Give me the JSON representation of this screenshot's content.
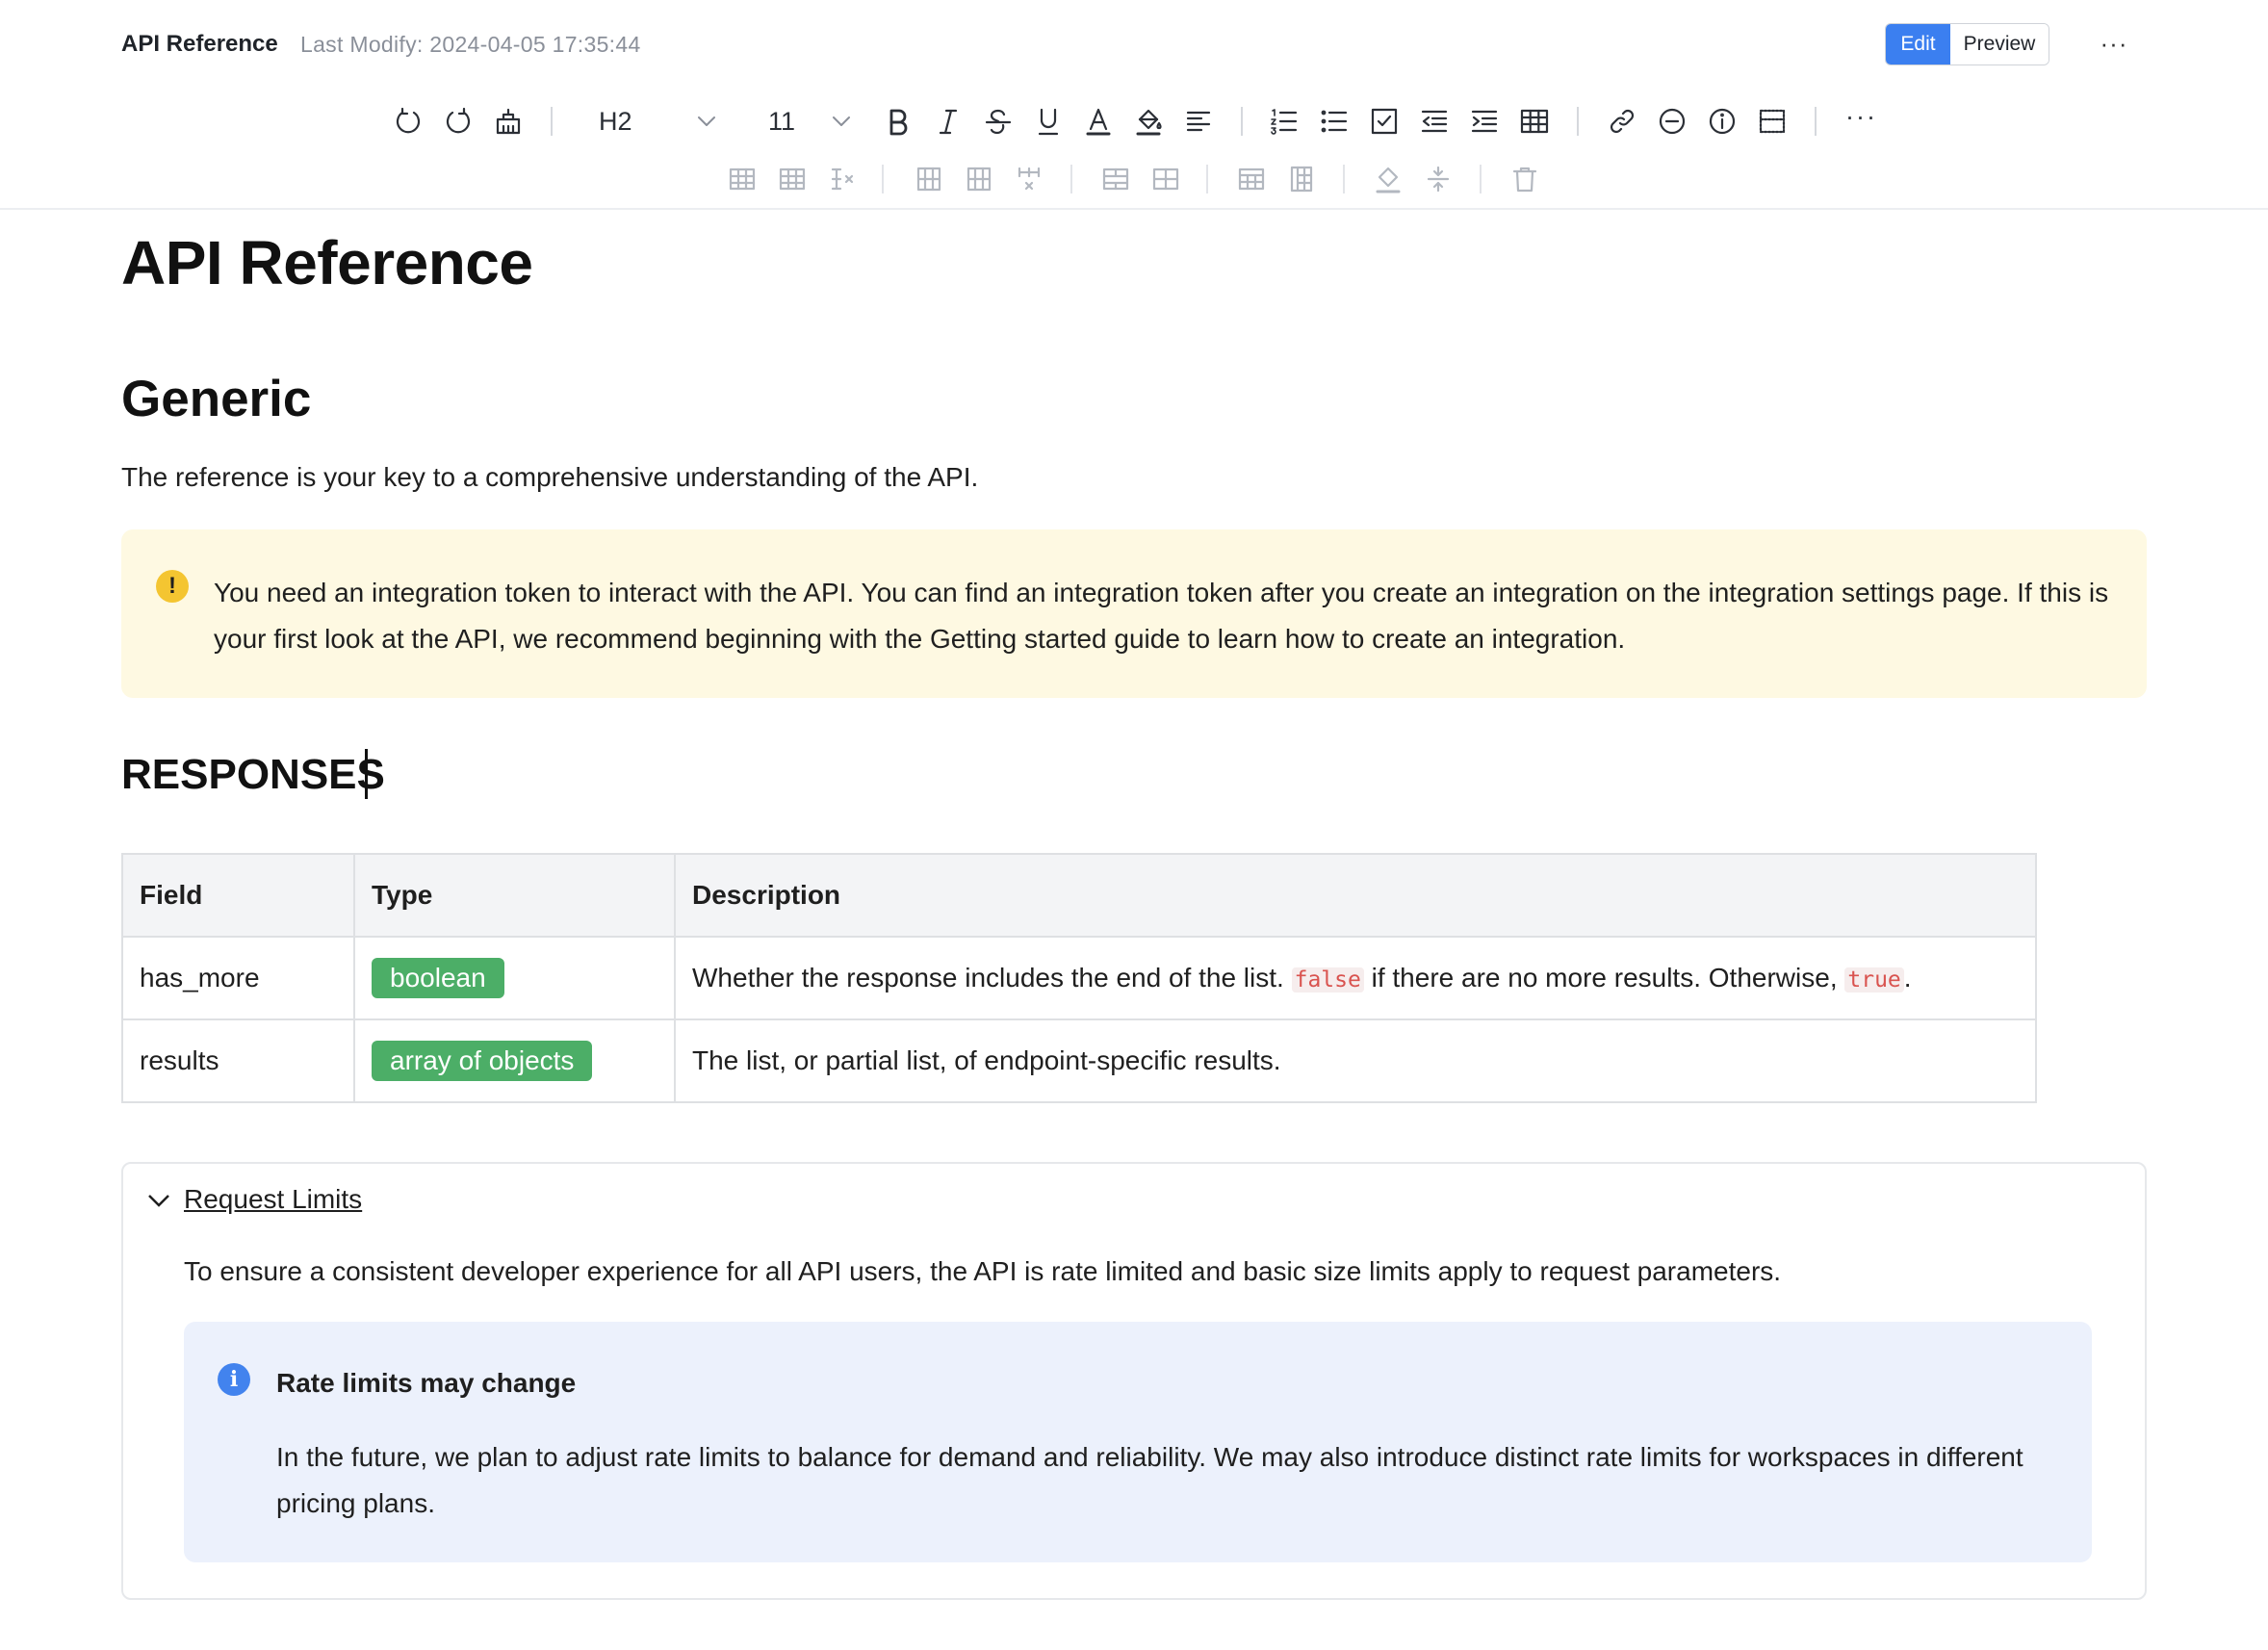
{
  "header": {
    "doc_title": "API Reference",
    "last_modify": "Last Modify: 2024-04-05 17:35:44",
    "edit_label": "Edit",
    "preview_label": "Preview",
    "more_label": "···"
  },
  "toolbar": {
    "heading_value": "H2",
    "font_size_value": "11",
    "more_label": "···",
    "icons_row1": [
      "undo-icon",
      "redo-icon",
      "format-painter-icon",
      "heading-dropdown",
      "font-size-dropdown",
      "bold-icon",
      "italic-icon",
      "strikethrough-icon",
      "underline-icon",
      "font-color-icon",
      "highlight-color-icon",
      "align-left-icon",
      "ordered-list-icon",
      "bullet-list-icon",
      "checklist-icon",
      "outdent-icon",
      "indent-icon",
      "table-icon",
      "link-icon",
      "divider-icon",
      "callout-icon",
      "code-block-icon",
      "more-icon"
    ],
    "icons_row2": [
      "insert-row-above-icon",
      "insert-row-below-icon",
      "delete-row-icon",
      "insert-column-left-icon",
      "insert-column-right-icon",
      "delete-column-icon",
      "merge-cells-icon",
      "split-cells-icon",
      "header-row-icon",
      "header-column-icon",
      "cell-background-icon",
      "cell-align-icon",
      "delete-table-icon"
    ]
  },
  "content": {
    "title": "API Reference",
    "section_heading": "Generic",
    "intro": "The reference is your key to a comprehensive understanding of the API.",
    "warning_callout": {
      "icon": "!",
      "text": "You need an integration token to interact with the API. You can find an integration token after you create an integration on the integration settings page. If this is your first look at the API, we recommend beginning with the Getting started guide to learn how to create an integration."
    },
    "responses_heading": "RESPONSES",
    "table": {
      "headers": [
        "Field",
        "Type",
        "Description"
      ],
      "rows": [
        {
          "field": "has_more",
          "type": "boolean",
          "desc_before": "Whether the response includes the end of the list. ",
          "code1": "false",
          "desc_middle": " if there are no more results. Otherwise, ",
          "code2": "true",
          "desc_after": "."
        },
        {
          "field": "results",
          "type": "array of objects",
          "desc": "The list, or partial list, of endpoint-specific results."
        }
      ]
    },
    "toggle": {
      "title": "Request Limits",
      "text": "To ensure a consistent developer experience for all API users, the API is rate limited and basic size limits apply to request parameters.",
      "info_callout": {
        "icon": "i",
        "title": "Rate limits may change",
        "text": "In the future, we plan to adjust rate limits to balance for demand and reliability. We may also introduce distinct rate limits for workspaces in different pricing plans."
      }
    }
  },
  "colors": {
    "accent": "#3b7ff0",
    "tag_green": "#4cae67",
    "warning_bg": "#fef9e2",
    "info_bg": "#ecf1fc",
    "code_red": "#d9534f"
  }
}
